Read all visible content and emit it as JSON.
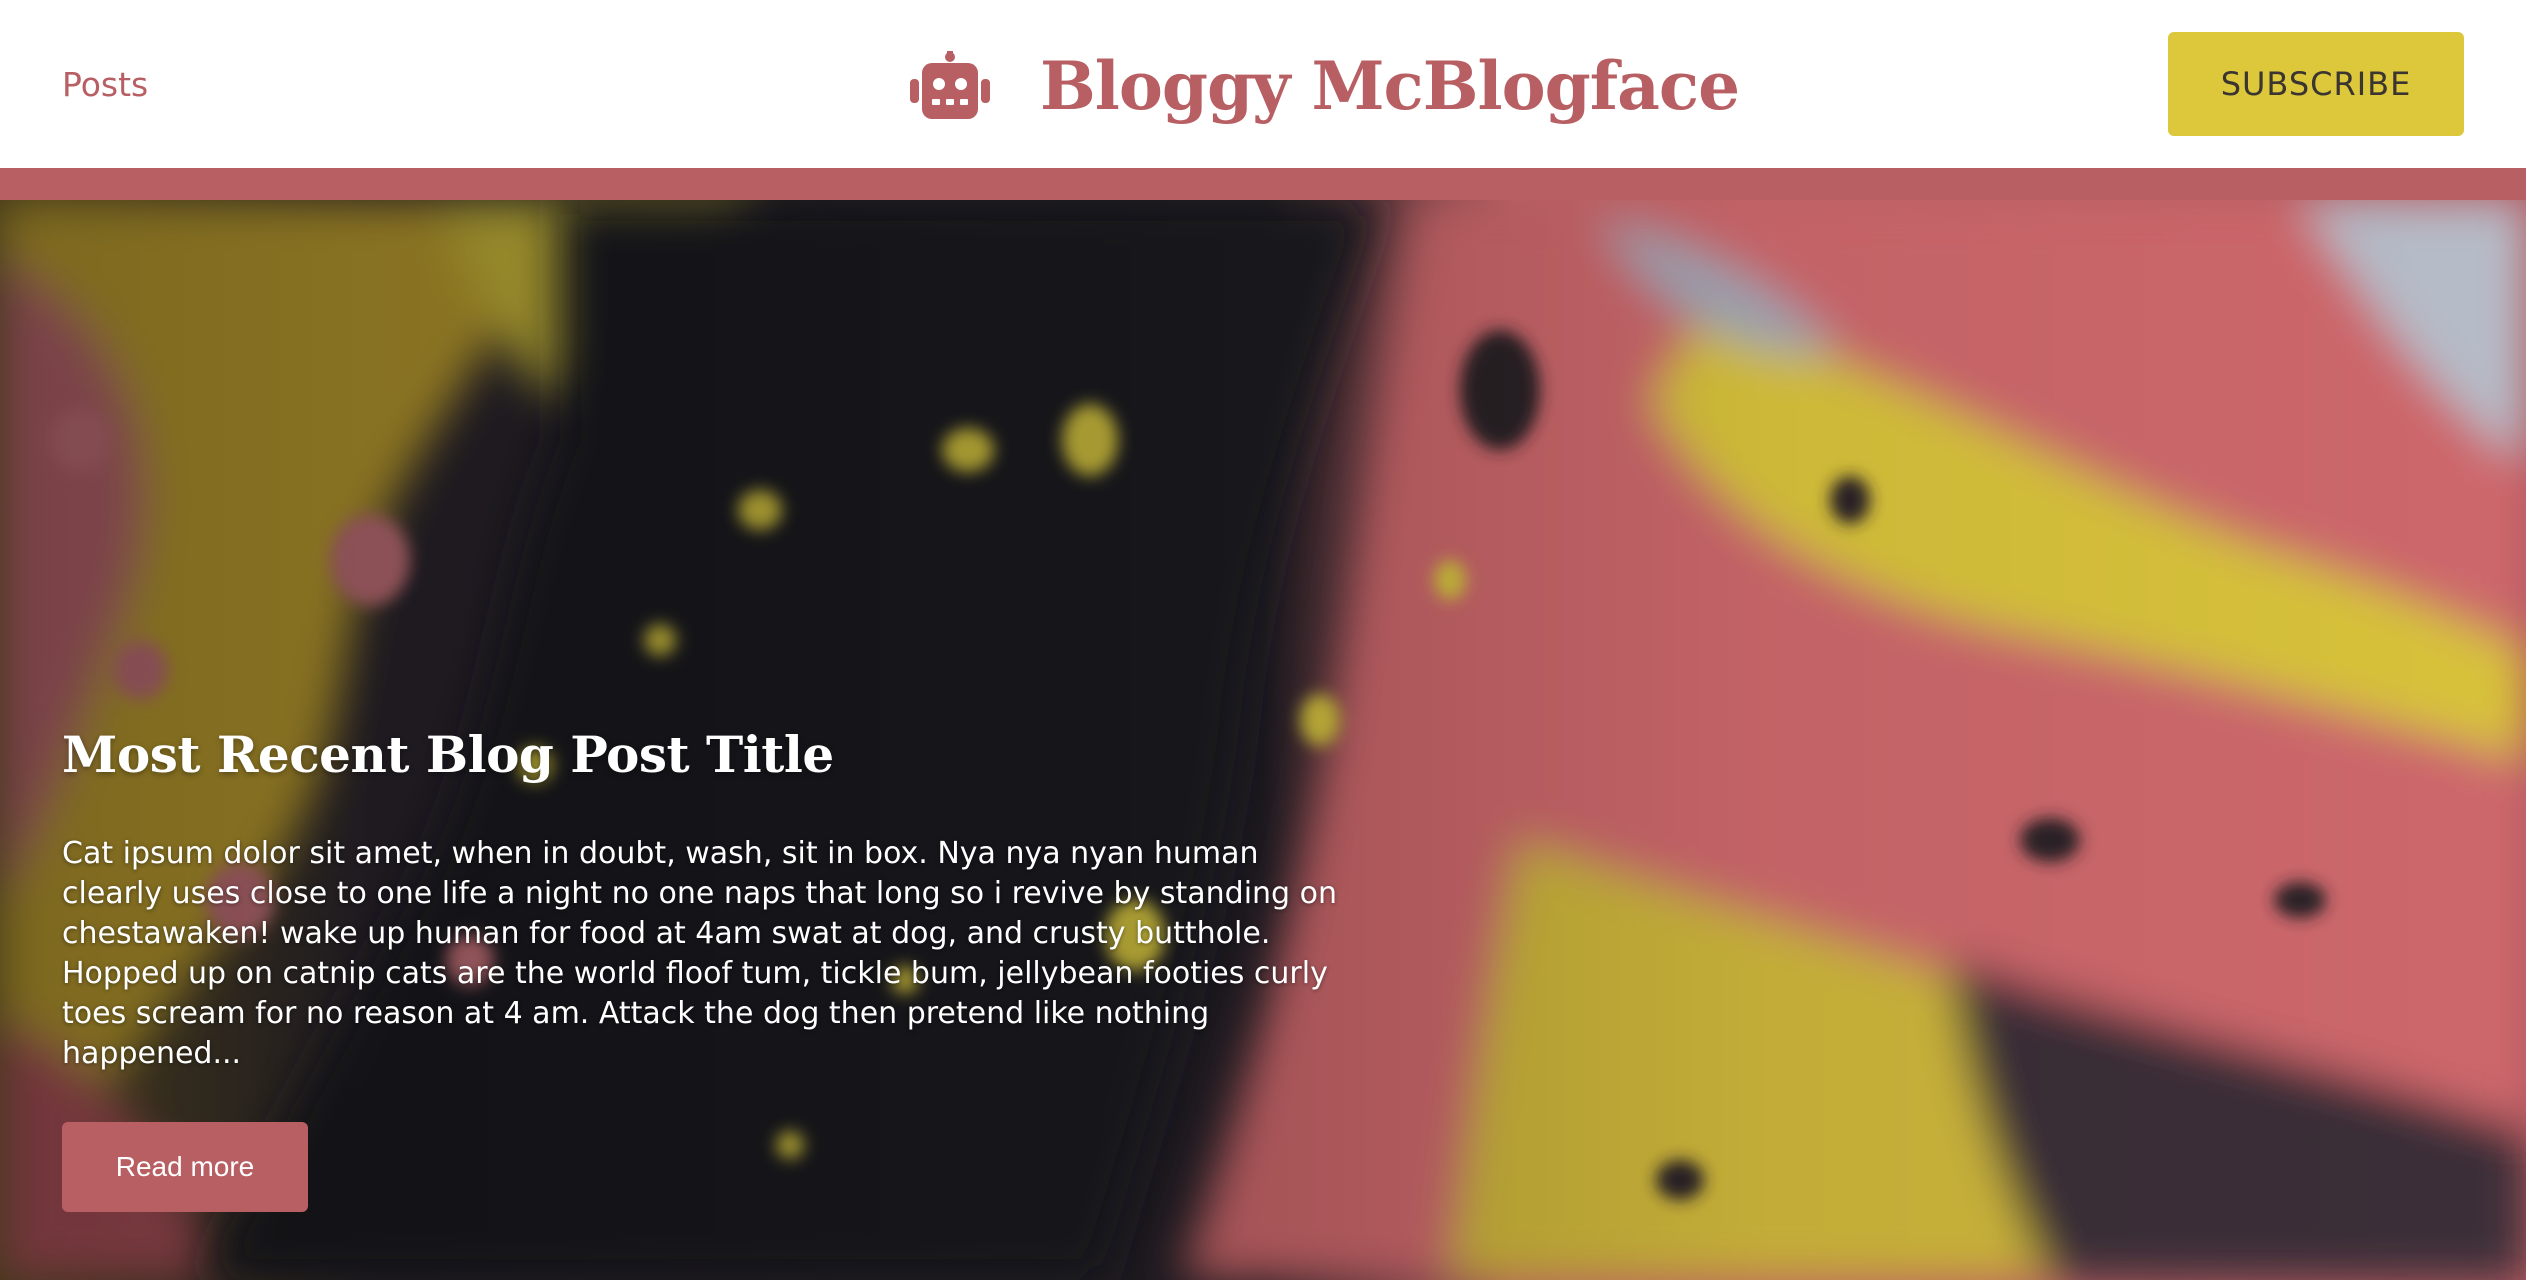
{
  "header": {
    "nav_posts": "Posts",
    "brand_name": "Bloggy McBlogface",
    "logo_icon": "robot-icon",
    "subscribe_label": "SUBSCRIBE"
  },
  "hero": {
    "background": "abstract-fluid-paint-image",
    "post_title": "Most Recent Blog Post Title",
    "excerpt": "Cat ipsum dolor sit amet, when in doubt, wash, sit in box. Nya nya nyan human clearly uses close to one life a night no one naps that long so i revive by standing on chestawaken! wake up human for food at 4am swat at dog, and crusty butthole. Hopped up on catnip cats are the world floof tum, tickle bum, jellybean footies curly toes scream for no reason at 4 am. Attack the dog then pretend like nothing happened...",
    "read_more_label": "Read more"
  },
  "colors": {
    "brand": "#b85f64",
    "accent": "#ddc73b",
    "header_bg": "#ffffff",
    "hero_text": "#ffffff"
  }
}
